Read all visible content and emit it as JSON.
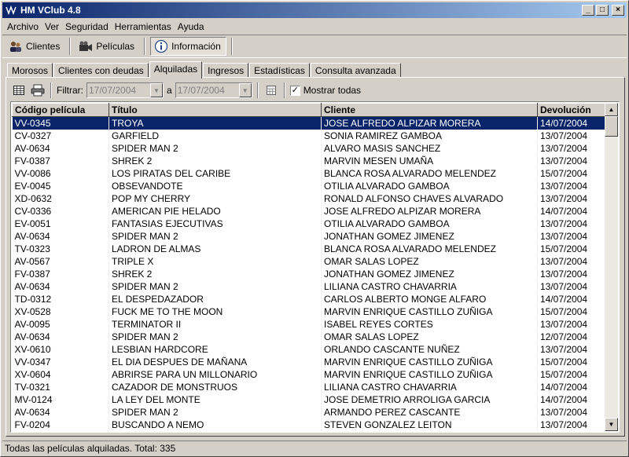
{
  "window": {
    "title": "HM VClub 4.8",
    "app_icon": "vclub-logo-icon"
  },
  "title_buttons": {
    "minimize": "_",
    "maximize": "□",
    "close": "×"
  },
  "menu": [
    "Archivo",
    "Ver",
    "Seguridad",
    "Herramientas",
    "Ayuda"
  ],
  "toolbar": {
    "clientes": "Clientes",
    "peliculas": "Películas",
    "informacion": "Información"
  },
  "tabs": [
    "Morosos",
    "Clientes con deudas",
    "Alquiladas",
    "Ingresos",
    "Estadísticas",
    "Consulta avanzada"
  ],
  "active_tab": "Alquiladas",
  "filter": {
    "label": "Filtrar:",
    "from": "17/07/2004",
    "sep": "a",
    "to": "17/07/2004",
    "show_all_label": "Mostrar todas",
    "show_all_checked": true,
    "check_mark": "✓"
  },
  "table": {
    "columns": [
      "Código película",
      "Título",
      "Cliente",
      "Devolución"
    ],
    "rows": [
      [
        "VV-0345",
        "TROYA",
        "JOSE ALFREDO ALPIZAR MORERA",
        "14/07/2004"
      ],
      [
        "CV-0327",
        "GARFIELD",
        "SONIA RAMIREZ GAMBOA",
        "13/07/2004"
      ],
      [
        "AV-0634",
        "SPIDER MAN 2",
        "ALVARO MASIS SANCHEZ",
        "13/07/2004"
      ],
      [
        "FV-0387",
        "SHREK 2",
        "MARVIN MESEN UMAÑA",
        "13/07/2004"
      ],
      [
        "VV-0086",
        "LOS PIRATAS DEL CARIBE",
        "BLANCA ROSA ALVARADO MELENDEZ",
        "15/07/2004"
      ],
      [
        "EV-0045",
        "OBSEVANDOTE",
        "OTILIA ALVARADO GAMBOA",
        "13/07/2004"
      ],
      [
        "XD-0632",
        "POP MY CHERRY",
        "RONALD ALFONSO CHAVES ALVARADO",
        "13/07/2004"
      ],
      [
        "CV-0336",
        "AMERICAN PIE HELADO",
        "JOSE ALFREDO ALPIZAR MORERA",
        "14/07/2004"
      ],
      [
        "EV-0051",
        "FANTASIAS EJECUTIVAS",
        "OTILIA ALVARADO GAMBOA",
        "13/07/2004"
      ],
      [
        "AV-0634",
        "SPIDER MAN 2",
        "JONATHAN GOMEZ JIMENEZ",
        "13/07/2004"
      ],
      [
        "TV-0323",
        "LADRON DE ALMAS",
        "BLANCA ROSA ALVARADO MELENDEZ",
        "15/07/2004"
      ],
      [
        "AV-0567",
        "TRIPLE X",
        "OMAR SALAS LOPEZ",
        "13/07/2004"
      ],
      [
        "FV-0387",
        "SHREK 2",
        "JONATHAN GOMEZ JIMENEZ",
        "13/07/2004"
      ],
      [
        "AV-0634",
        "SPIDER MAN 2",
        "LILIANA CASTRO CHAVARRIA",
        "13/07/2004"
      ],
      [
        "TD-0312",
        "EL DESPEDAZADOR",
        "CARLOS ALBERTO MONGE ALFARO",
        "14/07/2004"
      ],
      [
        "XV-0528",
        "FUCK ME TO THE MOON",
        "MARVIN ENRIQUE CASTILLO ZUÑIGA",
        "15/07/2004"
      ],
      [
        "AV-0095",
        "TERMINATOR II",
        "ISABEL REYES CORTES",
        "13/07/2004"
      ],
      [
        "AV-0634",
        "SPIDER MAN 2",
        "OMAR SALAS LOPEZ",
        "12/07/2004"
      ],
      [
        "XV-0610",
        "LESBIAN HARDCORE",
        "ORLANDO CASCANTE NUÑEZ",
        "13/07/2004"
      ],
      [
        "VV-0347",
        "EL DIA DESPUES DE MAÑANA",
        "MARVIN ENRIQUE CASTILLO ZUÑIGA",
        "15/07/2004"
      ],
      [
        "XV-0604",
        "ABRIRSE PARA UN MILLONARIO",
        "MARVIN ENRIQUE CASTILLO ZUÑIGA",
        "15/07/2004"
      ],
      [
        "TV-0321",
        "CAZADOR DE MONSTRUOS",
        "LILIANA CASTRO CHAVARRIA",
        "14/07/2004"
      ],
      [
        "MV-0124",
        "LA LEY DEL MONTE",
        "JOSE DEMETRIO ARROLIGA GARCIA",
        "14/07/2004"
      ],
      [
        "AV-0634",
        "SPIDER MAN 2",
        "ARMANDO PEREZ CASCANTE",
        "13/07/2004"
      ],
      [
        "FV-0204",
        "BUSCANDO A NEMO",
        "STEVEN GONZALEZ LEITON",
        "13/07/2004"
      ]
    ],
    "selected_row": 0
  },
  "status": "Todas las películas alquiladas.  Total: 335",
  "colors": {
    "title_start": "#0a246a",
    "title_end": "#a6caf0",
    "selection": "#0a246a",
    "face": "#d4d0c8"
  }
}
